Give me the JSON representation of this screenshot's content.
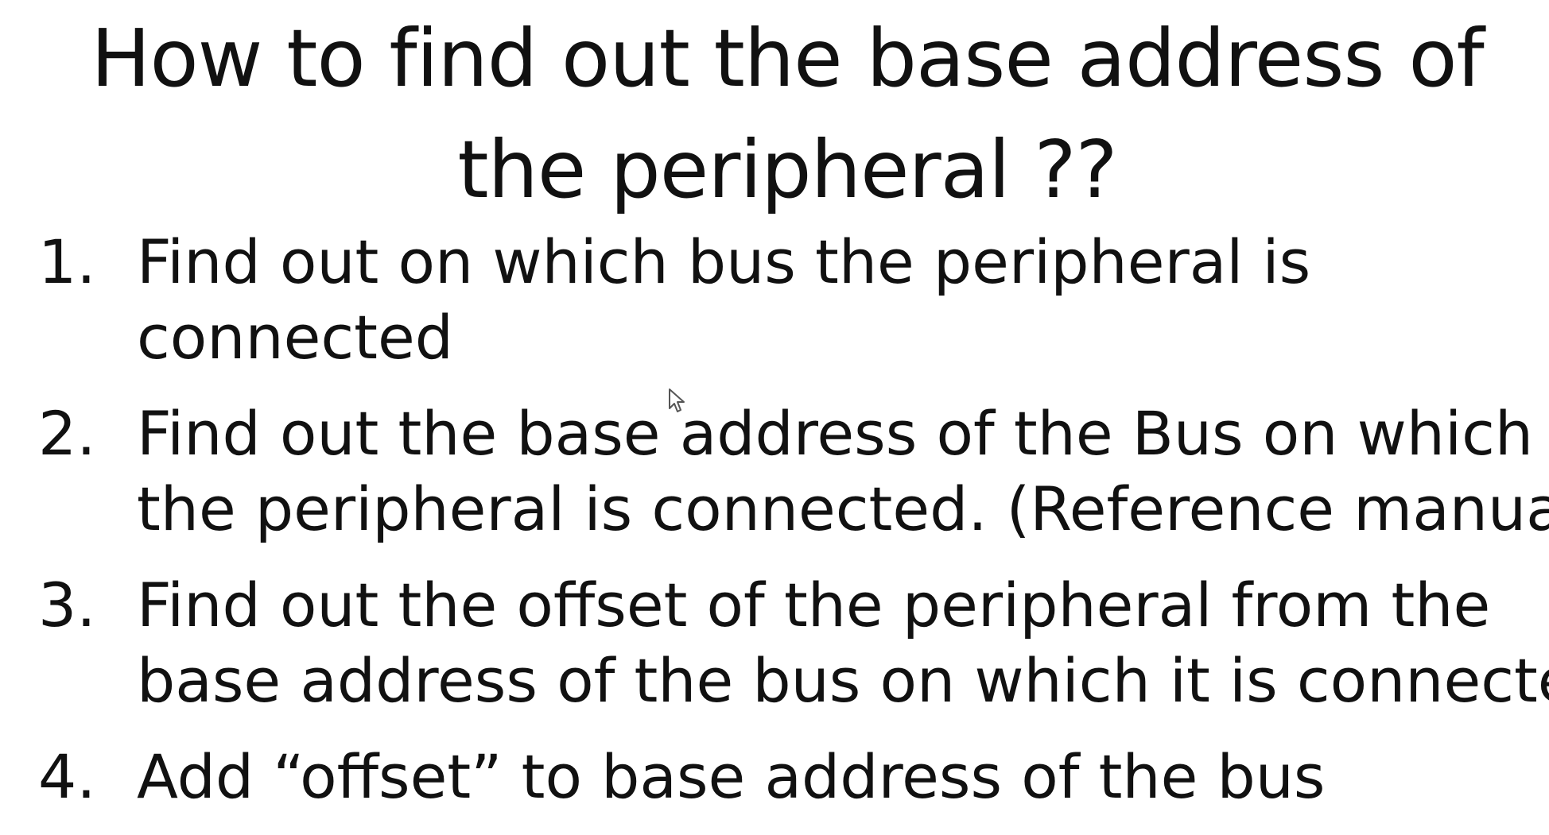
{
  "slide": {
    "title_lines": [
      "How to find out the base address of",
      "the peripheral ??"
    ],
    "steps": [
      {
        "number": "1.",
        "lines": [
          "Find out on which bus the peripheral is",
          "connected"
        ]
      },
      {
        "number": "2.",
        "lines": [
          "Find out the base address of the Bus on which",
          "the peripheral is connected. (Reference manual )"
        ]
      },
      {
        "number": "3.",
        "lines": [
          "Find out the offset of the peripheral from the",
          "base address of the bus on which it is connected"
        ]
      },
      {
        "number": "4.",
        "lines": [
          "Add “offset” to base address of the bus"
        ]
      }
    ]
  },
  "icons": {
    "cursor": "mouse-pointer-icon"
  },
  "colors": {
    "background": "#ffffff",
    "text": "#111111"
  }
}
